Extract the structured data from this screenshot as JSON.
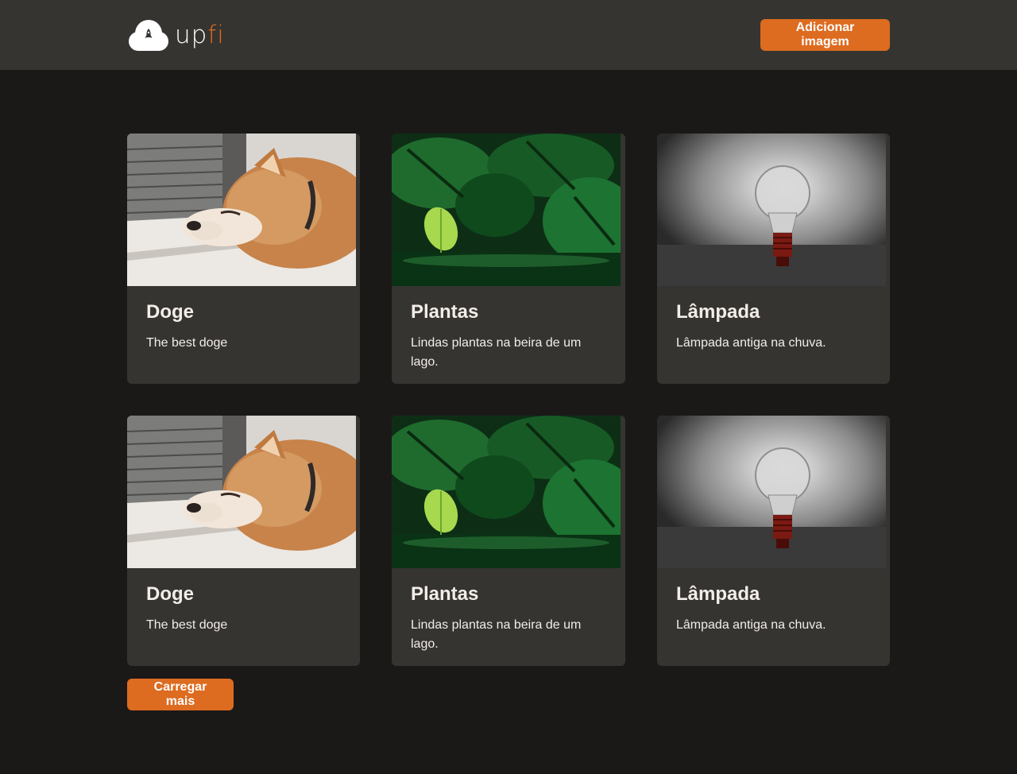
{
  "header": {
    "logo": {
      "part1": "up",
      "part2": "fi",
      "icon": "cloud-rocket-icon"
    },
    "add_button_label": "Adicionar imagem"
  },
  "cards": [
    {
      "title": "Doge",
      "description": "The best doge",
      "image": "shiba-dog-photo"
    },
    {
      "title": "Plantas",
      "description": "Lindas plantas na beira de um lago.",
      "image": "monstera-plants-photo"
    },
    {
      "title": "Lâmpada",
      "description": "Lâmpada antiga na chuva.",
      "image": "lightbulb-rain-photo"
    },
    {
      "title": "Doge",
      "description": "The best doge",
      "image": "shiba-dog-photo"
    },
    {
      "title": "Plantas",
      "description": "Lindas plantas na beira de um lago.",
      "image": "monstera-plants-photo"
    },
    {
      "title": "Lâmpada",
      "description": "Lâmpada antiga na chuva.",
      "image": "lightbulb-rain-photo"
    }
  ],
  "load_more_label": "Carregar mais",
  "colors": {
    "accent": "#dd6b20",
    "background": "#1b1918",
    "surface": "#353431",
    "text": "#f3ede8"
  }
}
